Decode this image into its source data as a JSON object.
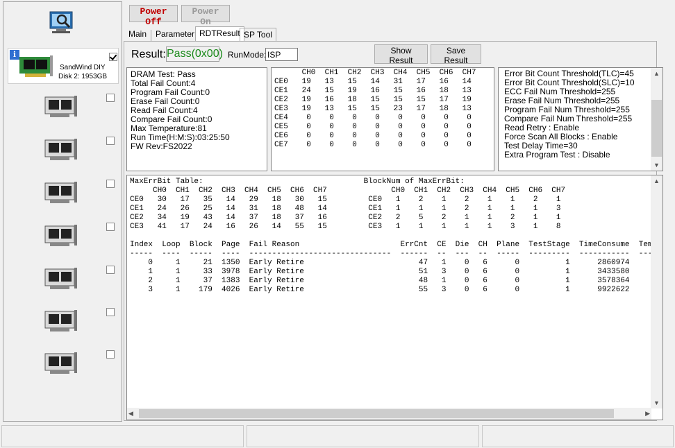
{
  "sidebar": {
    "device": {
      "name": "SandWind DIY",
      "disk": "Disk 2: 1953GB",
      "checked": true
    },
    "slots": 7
  },
  "toolbar": {
    "power_off": "Power Off",
    "power_on": "Power On"
  },
  "tabs": [
    "Main",
    "Parameter",
    "RDTResult",
    "SP Tool"
  ],
  "result": {
    "label": "Result:",
    "value": "Pass(0x00)",
    "value_color": "#1a8a1a",
    "runmode_label": "RunMode:",
    "runmode_value": "ISP",
    "show_result": "Show Result",
    "save_result": "Save Result"
  },
  "summary": [
    "DRAM Test: Pass",
    "Total Fail Count:4",
    "Program Fail Count:0",
    "Erase Fail Count:0",
    "Read Fail Count:4",
    "Compare Fail Count:0",
    "Max Temperature:81",
    "Run Time(H:M:S):03:25:50",
    "FW Rev:FS2022"
  ],
  "ce_table": [
    "      CH0  CH1  CH2  CH3  CH4  CH5  CH6  CH7",
    "CE0   19   13   15   14   31   17   16   14",
    "CE1   24   15   19   16   15   16   18   13",
    "CE2   19   16   18   15   15   15   17   19",
    "CE3   19   13   15   15   23   17   18   13",
    "CE4    0    0    0    0    0    0    0    0",
    "CE5    0    0    0    0    0    0    0    0",
    "CE6    0    0    0    0    0    0    0    0",
    "CE7    0    0    0    0    0    0    0    0"
  ],
  "thresholds": [
    "Error Bit Count Threshold(TLC)=45",
    "Error Bit Count Threshold(SLC)=10",
    "ECC Fail Num Threshold=255",
    "Erase Fail Num Threshold=255",
    "Program Fail Num Threshold=255",
    "Compare Fail Num Threshold=255",
    "Read Retry : Enable",
    "Force Scan All Blocks : Enable",
    "Test Delay Time=30",
    "Extra Program Test : Disable"
  ],
  "detail": [
    "MaxErrBit Table:                                   BlockNum of MaxErrBit:",
    "     CH0  CH1  CH2  CH3  CH4  CH5  CH6  CH7              CH0  CH1  CH2  CH3  CH4  CH5  CH6  CH7",
    "CE0   30   17   35   14   29   18   30   15         CE0   1    2    1    2    1    1    2    1",
    "CE1   24   26   25   14   31   18   48   14         CE1   1    1    1    2    1    1    1    3",
    "CE2   34   19   43   14   37   18   37   16         CE2   2    5    2    1    1    2    1    1",
    "CE3   41   17   24   16   26   14   55   15         CE3   1    1    1    1    1    3    1    8",
    "",
    "Index  Loop  Block  Page  Fail Reason                      ErrCnt  CE  Die  CH  Plane  TestStage  TimeConsume  Tempe",
    "-----  ----  -----  ----  -------------------------------  ------  --  ---  --  -----  ---------  -----------  -----",
    "    0     1     21  1350  Early Retire                         47   1    0   6      0          1      2860974",
    "    1     1     33  3978  Early Retire                         51   3    0   6      0          1      3433580",
    "    2     1     37  1383  Early Retire                         48   1    0   6      0          1      3578364",
    "    3     1    179  4026  Early Retire                         55   3    0   6      0          1      9922622"
  ]
}
